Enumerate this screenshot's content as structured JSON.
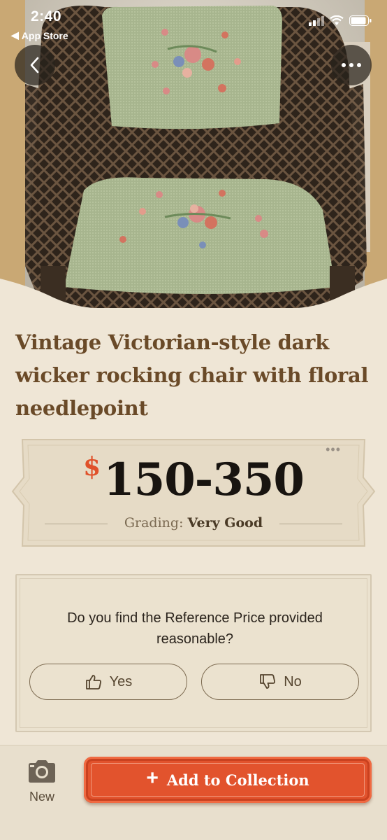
{
  "status_bar": {
    "time": "2:40",
    "back_app": "App Store"
  },
  "header": {
    "back_icon": "chevron-left-icon",
    "more_icon": "more-horizontal-icon"
  },
  "item": {
    "title": "Vintage Victorian-style dark wicker rocking chair with floral needlepoint"
  },
  "price": {
    "currency": "$",
    "value": "150-350",
    "grading_label": "Grading:",
    "grading_value": "Very Good",
    "menu_glyph": "•••"
  },
  "feedback": {
    "question": "Do you find the Reference Price provided reasonable?",
    "yes_label": "Yes",
    "no_label": "No",
    "yes_icon": "thumbs-up-icon",
    "no_icon": "thumbs-down-icon"
  },
  "bottom_bar": {
    "new_label": "New",
    "new_icon": "camera-icon",
    "add_label": "Add to Collection",
    "add_glyph": "+"
  },
  "colors": {
    "accent": "#e2532d",
    "currency": "#e0512a",
    "title": "#6a4a28",
    "background": "#efe6d6"
  }
}
